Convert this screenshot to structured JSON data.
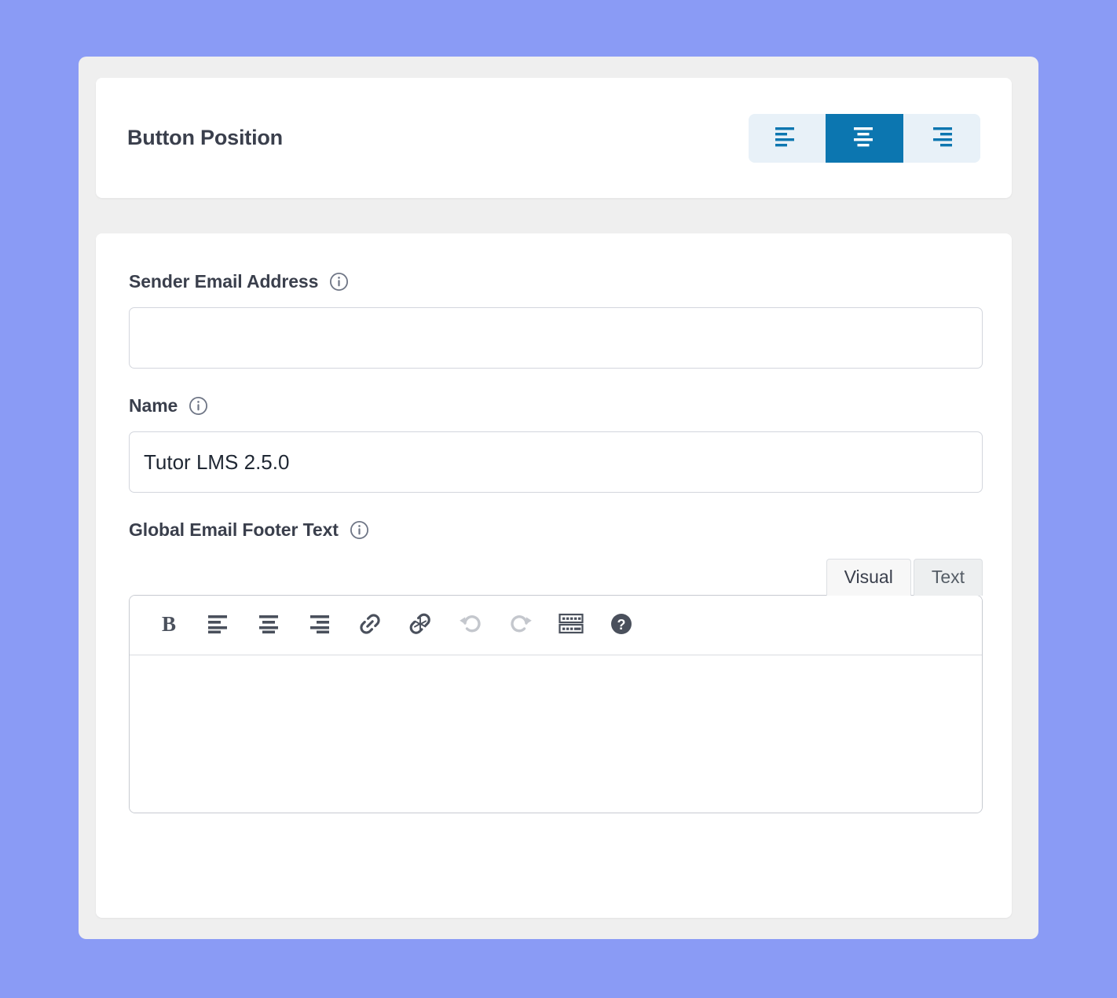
{
  "theme": {
    "page_background": "#8a9bf5",
    "panel_background": "#efefef",
    "card_background": "#ffffff",
    "accent_active": "#0c76b0",
    "segment_background": "#e8f1f8",
    "text_primary": "#3a3f4c",
    "border": "#d3d6dd",
    "icon_dark": "#4a505c",
    "icon_disabled": "#c4c7cd"
  },
  "button_position": {
    "title": "Button Position",
    "options": [
      {
        "value": "left",
        "icon": "align-left-icon",
        "active": false
      },
      {
        "value": "center",
        "icon": "align-center-icon",
        "active": true
      },
      {
        "value": "right",
        "icon": "align-right-icon",
        "active": false
      }
    ]
  },
  "form": {
    "sender_email": {
      "label": "Sender Email Address",
      "info_icon": "info-circle-icon",
      "value": "",
      "placeholder": ""
    },
    "name": {
      "label": "Name",
      "info_icon": "info-circle-icon",
      "value": "Tutor LMS 2.5.0",
      "placeholder": ""
    },
    "footer_text": {
      "label": "Global Email Footer Text",
      "info_icon": "info-circle-icon",
      "value": "",
      "tabs": [
        {
          "label": "Visual",
          "active": true
        },
        {
          "label": "Text",
          "active": false
        }
      ],
      "toolbar": [
        {
          "name": "bold-icon",
          "label": "Bold",
          "disabled": false
        },
        {
          "name": "align-left-icon",
          "label": "Align left",
          "disabled": false
        },
        {
          "name": "align-center-icon",
          "label": "Align center",
          "disabled": false
        },
        {
          "name": "align-right-icon",
          "label": "Align right",
          "disabled": false
        },
        {
          "name": "link-icon",
          "label": "Insert link",
          "disabled": false
        },
        {
          "name": "unlink-icon",
          "label": "Remove link",
          "disabled": false
        },
        {
          "name": "undo-icon",
          "label": "Undo",
          "disabled": true
        },
        {
          "name": "redo-icon",
          "label": "Redo",
          "disabled": true
        },
        {
          "name": "keyboard-icon",
          "label": "Keyboard shortcuts",
          "disabled": false
        },
        {
          "name": "help-icon",
          "label": "Help",
          "disabled": false
        }
      ]
    }
  }
}
